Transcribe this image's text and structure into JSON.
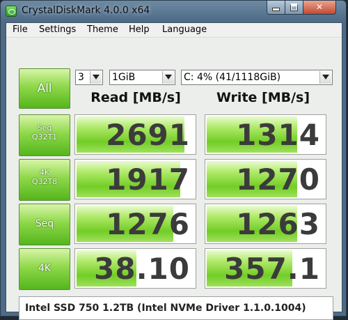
{
  "window": {
    "title": "CrystalDiskMark 4.0.0 x64"
  },
  "menu": {
    "file": "File",
    "settings": "Settings",
    "theme": "Theme",
    "help": "Help",
    "language": "Language"
  },
  "controls": {
    "all_label": "All",
    "count": "3",
    "size": "1GiB",
    "drive": "C: 4% (41/1118GiB)"
  },
  "columns": {
    "read": "Read [MB/s]",
    "write": "Write [MB/s]"
  },
  "rows": [
    {
      "label1": "Seq",
      "label2": "Q32T1",
      "read": "2691",
      "write": "1314",
      "read_fill": 0.92,
      "write_fill": 0.77
    },
    {
      "label1": "4K",
      "label2": "Q32T8",
      "read": "1917",
      "write": "1270",
      "read_fill": 0.88,
      "write_fill": 0.77
    },
    {
      "label1": "Seq",
      "label2": "",
      "read": "1276",
      "write": "1263",
      "read_fill": 0.82,
      "write_fill": 0.77
    },
    {
      "label1": "4K",
      "label2": "",
      "read": "38.10",
      "write": "357.1",
      "read_fill": 0.51,
      "write_fill": 0.73
    }
  ],
  "info": "Intel SSD 750 1.2TB (Intel NVMe Driver 1.1.0.1004)"
}
